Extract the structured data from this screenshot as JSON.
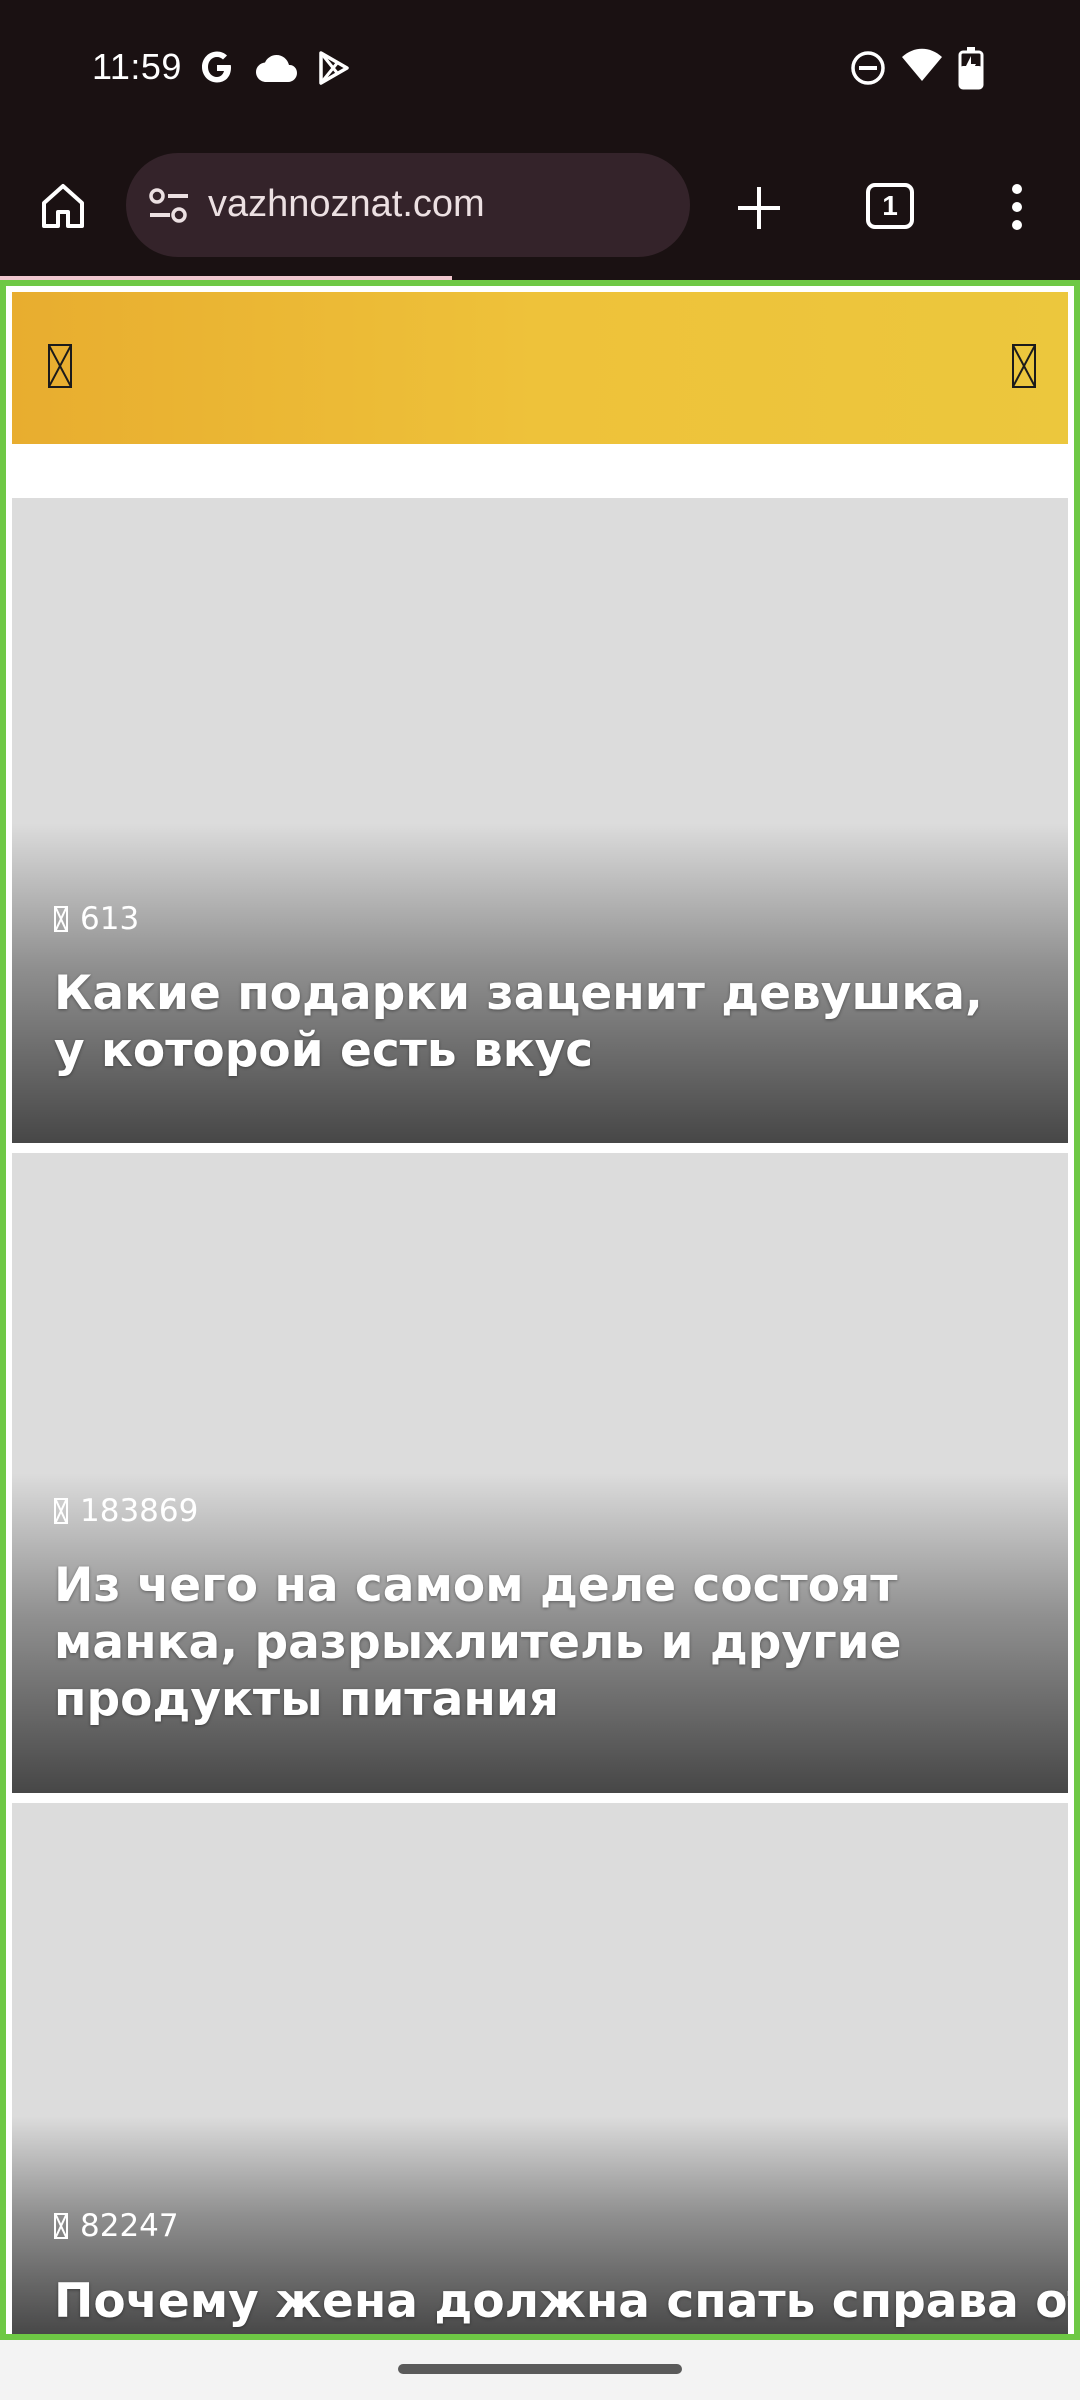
{
  "status_bar": {
    "time": "11:59",
    "left_icons": [
      "google-icon",
      "cloud-icon",
      "play-store-icon"
    ],
    "right_icons": [
      "dnd-icon",
      "wifi-icon",
      "battery-icon"
    ]
  },
  "browser": {
    "url": "vazhnoznat.com",
    "tab_count": "1"
  },
  "site": {
    "header_color": "#eec23a",
    "menu_icon": "missing-glyph-icon",
    "search_icon": "missing-glyph-icon"
  },
  "articles": [
    {
      "views": "613",
      "title": "Какие подарки заценит девушка, у которой есть вкус"
    },
    {
      "views": "183869",
      "title": "Из чего на самом деле состоят манка, разрыхлитель и другие продукты питания"
    },
    {
      "views": "82247",
      "title": "Почему жена должна спать справа от"
    }
  ],
  "colors": {
    "frame": "#6ec845",
    "chrome_bg": "#1a1112",
    "url_pill": "#34232a"
  }
}
